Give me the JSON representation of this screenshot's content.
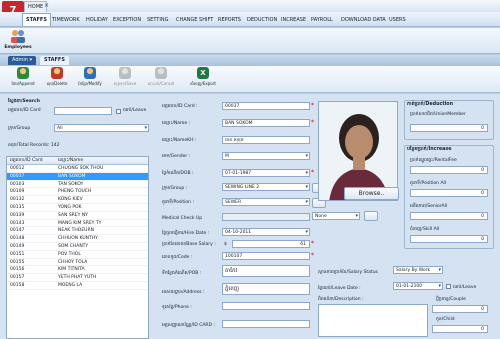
{
  "window": {
    "home_tab": "HOME",
    "close_tab": "×"
  },
  "menu": [
    {
      "label": "STAFFS",
      "active": true
    },
    {
      "label": "TIMEWORK"
    },
    {
      "label": "HOLIDAY"
    },
    {
      "label": "EXCEPTION"
    },
    {
      "label": "SETTING"
    },
    {
      "label": "CHANGE SHIFT"
    },
    {
      "label": "REPORTS"
    },
    {
      "label": "DEDUCTION"
    },
    {
      "label": "INCREASE"
    },
    {
      "label": "PAYROLL"
    },
    {
      "label": "DOWNLOAD DATA"
    },
    {
      "label": "USERS"
    }
  ],
  "ribbon": {
    "employees_label": "Employees"
  },
  "tabs": {
    "admin": "Admin",
    "staffs": "STAFFS"
  },
  "toolbar": [
    {
      "label": "ថែម/Append",
      "icon": "add-user-icon"
    },
    {
      "label": "លុប/Delete",
      "icon": "delete-user-icon"
    },
    {
      "label": "កែប្រែ/Modify",
      "icon": "edit-user-icon"
    },
    {
      "label": "រក្សាទុក/Save",
      "icon": "save-user-icon"
    },
    {
      "label": "បោះបង់/Cancel",
      "icon": "cancel-user-icon"
    },
    {
      "label": "នាំចេញ/Export",
      "icon": "excel-icon"
    }
  ],
  "search": {
    "title": "ស្វែងរក/Search",
    "id_label": "អត្តលេខ/ID Card",
    "id_value": "",
    "leave_label": "ឈប់/Leave",
    "group_label": "ក្រុម/Group",
    "group_value": "All",
    "total_label": "សរុប/Total Records: 142"
  },
  "grid": {
    "columns": [
      "អត្តលេខ/ID Card",
      "ឈ្មោះ/Name"
    ],
    "selected_index": 1,
    "rows": [
      [
        "00012",
        "CHUONG SOK THOU"
      ],
      [
        "00037",
        "BAN SOKOM"
      ],
      [
        "00103",
        "TAN SOKOY"
      ],
      [
        "00109",
        "PHENG TOUCH"
      ],
      [
        "00132",
        "KONG KIEV"
      ],
      [
        "00135",
        "YONG POK"
      ],
      [
        "00139",
        "SAN SREY NY"
      ],
      [
        "00143",
        "MANG KIM SREY TY"
      ],
      [
        "00147",
        "NEAK THOEURN"
      ],
      [
        "00148",
        "CHHUON KUNTHY"
      ],
      [
        "00149",
        "SOM CHANTY"
      ],
      [
        "00151",
        "POV THOL"
      ],
      [
        "00155",
        "CHHOY TOLA"
      ],
      [
        "00156",
        "KIM TITNITA"
      ],
      [
        "00157",
        "YETH PHAT YUTH"
      ],
      [
        "00158",
        "MOENG LA"
      ]
    ]
  },
  "form": {
    "id_card": {
      "label": "អត្តលេខ/ID Card :",
      "value": "00037"
    },
    "name": {
      "label": "ឈ្មោះ/Name :",
      "value": "BAN SOKOM"
    },
    "name_kh": {
      "label": "ឈ្មោះ/NameKH :",
      "value": "បាន សុខុម"
    },
    "gender": {
      "label": "ភេទ/Gender :",
      "value": "M"
    },
    "dob": {
      "label": "ថ្ងៃកំណើត/DOB :",
      "value": "07-01-1987"
    },
    "group": {
      "label": "ក្រុម/Group :",
      "value": "SEWING LINE 2"
    },
    "position": {
      "label": "តួនាទី/Position :",
      "value": "SEWER"
    },
    "medical": {
      "label": "Medical Check Up",
      "value": "",
      "option": "None"
    },
    "hire_date": {
      "label": "ថ្ងៃចូលធ្វើការ/Hire Date :",
      "value": "04-10-2011"
    },
    "base_salary": {
      "label": "ប្រាក់ខែគោល/Base Salary :",
      "currency": "$",
      "value": "61"
    },
    "code": {
      "label": "លេខកូដ/Code :",
      "value": "100107"
    },
    "pob": {
      "label": "ទីកន្លែងកំណើត/POB :",
      "value": "តាកែវ"
    },
    "address": {
      "label": "អាសយដ្ឋាន/Address :",
      "value": "ភ្នំពេញ"
    },
    "phone": {
      "label": "ទូរស័ព្ទ/Phone :",
      "value": ""
    },
    "id_card2": {
      "label": "អត្តសញ្ញាណប័ណ្ណ/ID CARD :",
      "value": ""
    }
  },
  "photo": {
    "browse_label": "Browse.."
  },
  "salary": {
    "status_label": "ស្ថានភាពប្រាក់ខែ/Salary Status",
    "status_value": "Salary By Work",
    "leave_date_label": "ថ្ងៃឈប់/Leave Date :",
    "leave_date_value": "01-01-2100",
    "leave_check": "ឈប់/Leave",
    "description_label": "ពិពណ៌នា/Description :",
    "description_value": ""
  },
  "deduction": {
    "title": "កាត់ប្រាក់/Deduction",
    "union_label": "ប្រាក់សហជីព/UnionMember",
    "union_value": "0"
  },
  "increase": {
    "title": "បន្ថែមប្រាក់/Increase",
    "rental_label": "ប្រាក់ឈ្នួលផ្ទះ/RentalFee",
    "rental_value": "0",
    "position_label": "តួនាទី/Position All",
    "position_value": "0",
    "senior_label": "អតីតភាព/SeniorAll",
    "senior_value": "0",
    "skill_label": "ជំនាញ/Skill All",
    "skill_value": "0"
  },
  "family": {
    "couple_label": "ប្តីប្រពន្ធ/Couple",
    "couple_value": "0",
    "child_label": "កូន/Child",
    "child_value": "0"
  },
  "colors": {
    "accent": "#3399ff",
    "required": "#dd0000",
    "brand": "#c6262e"
  }
}
